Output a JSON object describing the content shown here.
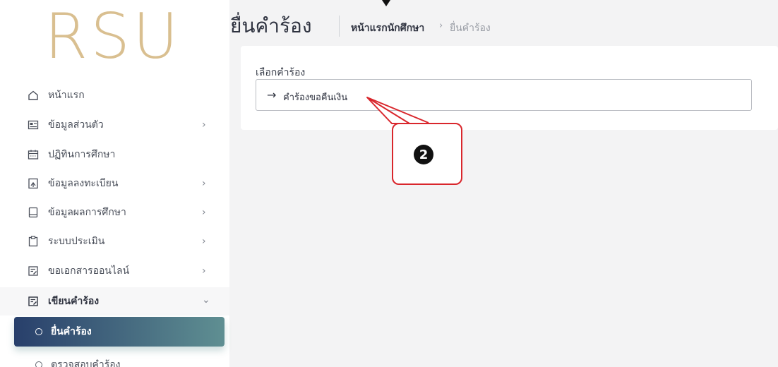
{
  "logo": {
    "text": "RSU"
  },
  "sidebar": {
    "items": [
      {
        "label": "หน้าแรก",
        "icon": "home-icon",
        "chevron": ""
      },
      {
        "label": "ข้อมูลส่วนตัว",
        "icon": "id-card-icon",
        "chevron": "›"
      },
      {
        "label": "ปฏิทินการศึกษา",
        "icon": "calendar-icon",
        "chevron": ""
      },
      {
        "label": "ข้อมูลลงทะเบียน",
        "icon": "register-icon",
        "chevron": "›"
      },
      {
        "label": "ข้อมูลผลการศึกษา",
        "icon": "book-icon",
        "chevron": "›"
      },
      {
        "label": "ระบบประเมิน",
        "icon": "clipboard-icon",
        "chevron": "›"
      },
      {
        "label": "ขอเอกสารออนไลน์",
        "icon": "document-edit-icon",
        "chevron": "›"
      },
      {
        "label": "เขียนคำร้อง",
        "icon": "document-edit-icon",
        "chevron": "⌄"
      }
    ],
    "sub_items": [
      {
        "label": "ยื่นคำร้อง",
        "active": true
      },
      {
        "label": "ตรวจสอบคำร้อง",
        "active": false
      }
    ]
  },
  "header": {
    "title": "ยื่นคำร้อง",
    "breadcrumb_home": "หน้าแรกนักศึกษา",
    "breadcrumb_sep": "›",
    "breadcrumb_current": "ยื่นคำร้อง"
  },
  "form": {
    "label": "เลือกคำร้อง",
    "select_arrow": "→",
    "select_value": "คำร้องขอคืนเงิน"
  },
  "annotation": {
    "badge": "2",
    "color": "#d9262c"
  },
  "colors": {
    "accent_start": "#283f6b",
    "accent_end": "#5f8f92",
    "logo": "#d9bf90"
  }
}
